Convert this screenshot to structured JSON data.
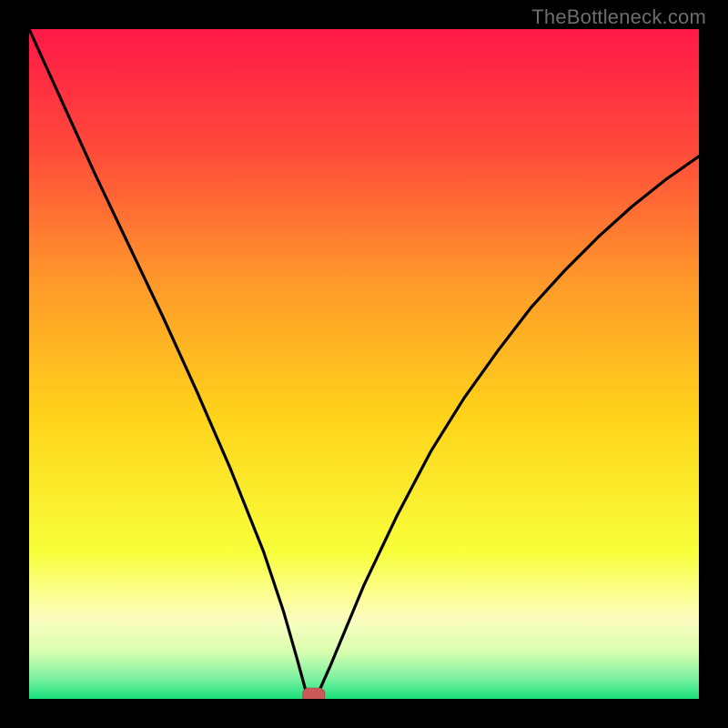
{
  "watermark": "TheBottleneck.com",
  "chart_data": {
    "type": "line",
    "title": "",
    "xlabel": "",
    "ylabel": "",
    "xlim": [
      0,
      100
    ],
    "ylim": [
      0,
      100
    ],
    "grid": false,
    "legend": false,
    "series": [
      {
        "name": "bottleneck-curve",
        "x": [
          0,
          5,
          10,
          15,
          20,
          25,
          30,
          35,
          38,
          40,
          41.5,
          43,
          45,
          50,
          55,
          60,
          65,
          70,
          75,
          80,
          85,
          90,
          95,
          100
        ],
        "y": [
          100,
          89,
          78,
          67.5,
          57,
          46,
          34.5,
          22,
          13,
          6,
          0.5,
          0.5,
          5,
          17,
          27.5,
          37,
          45,
          52,
          58.5,
          64,
          69,
          73.5,
          77.5,
          81
        ]
      }
    ],
    "marker": {
      "x": 42.5,
      "y": 0.5,
      "color": "#c85a5a"
    },
    "colors": {
      "background_gradient": {
        "top": "#ff1848",
        "upper_mid": "#ff7a2a",
        "mid": "#ffd31a",
        "lower_mid": "#f8ff6a",
        "pale_band": "#fdfdd0",
        "bottom": "#18e07a"
      },
      "curve": "#000000",
      "frame": "#000000"
    }
  }
}
